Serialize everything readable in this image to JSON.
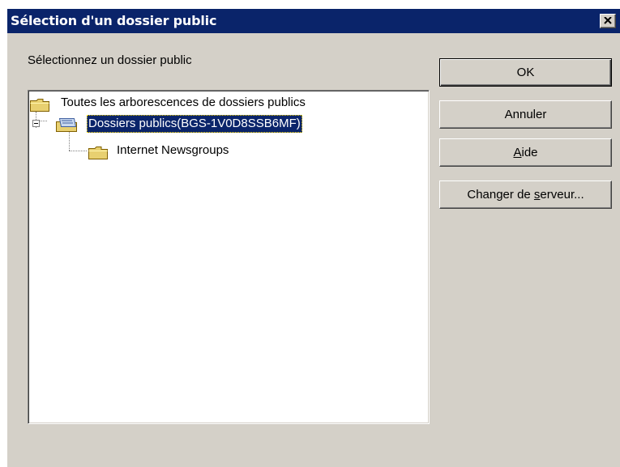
{
  "dialog": {
    "title": "Sélection d'un dossier public",
    "prompt": "Sélectionnez un dossier public"
  },
  "tree": {
    "root": {
      "label": "Toutes les arborescences de dossiers publics"
    },
    "server": {
      "label": "Dossiers publics(BGS-1V0D8SSB6MF)",
      "selected": true,
      "expanded": true
    },
    "child": {
      "label": "Internet Newsgroups"
    }
  },
  "buttons": {
    "ok": "OK",
    "cancel": "Annuler",
    "help_mnemonic": "A",
    "help_rest": "ide",
    "change_server_pre": "Changer de ",
    "change_server_mnemonic": "s",
    "change_server_post": "erveur..."
  },
  "colors": {
    "titlebar": "#0a246a",
    "face": "#d4d0c8",
    "selection": "#0a246a"
  }
}
